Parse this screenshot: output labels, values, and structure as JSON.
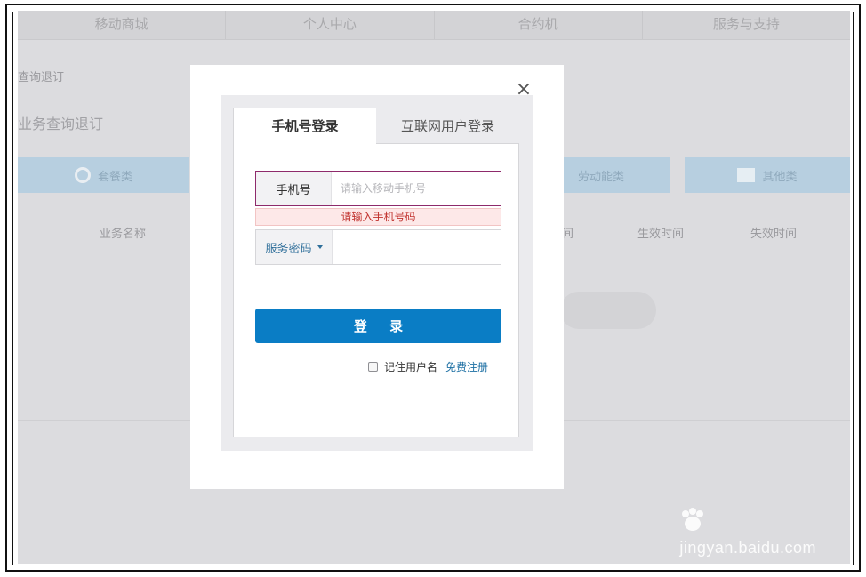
{
  "background": {
    "nav": [
      "移动商城",
      "个人中心",
      "合约机",
      "服务与支持"
    ],
    "breadcrumb": "查询退订",
    "page_title": "业务查询退订",
    "categories": [
      "套餐类",
      "劳动能类",
      "其他类"
    ],
    "columns": [
      "业务名称",
      "间",
      "生效时间",
      "失效时间"
    ]
  },
  "modal": {
    "close": "×",
    "tabs": [
      "手机号登录",
      "互联网用户登录"
    ],
    "phone_label": "手机号",
    "phone_placeholder": "请输入移动手机号",
    "error": "请输入手机号码",
    "password_label": "服务密码",
    "login_button": "登 录",
    "remember": "记住用户名",
    "register": "免费注册"
  },
  "watermark": {
    "logo": "Bai du 经验",
    "url": "jingyan.baidu.com"
  },
  "colors": {
    "primary_button": "#0a7dc5",
    "error_text": "#c0302c",
    "active_field_border": "#8e2a6b",
    "link": "#1c6fa3"
  }
}
